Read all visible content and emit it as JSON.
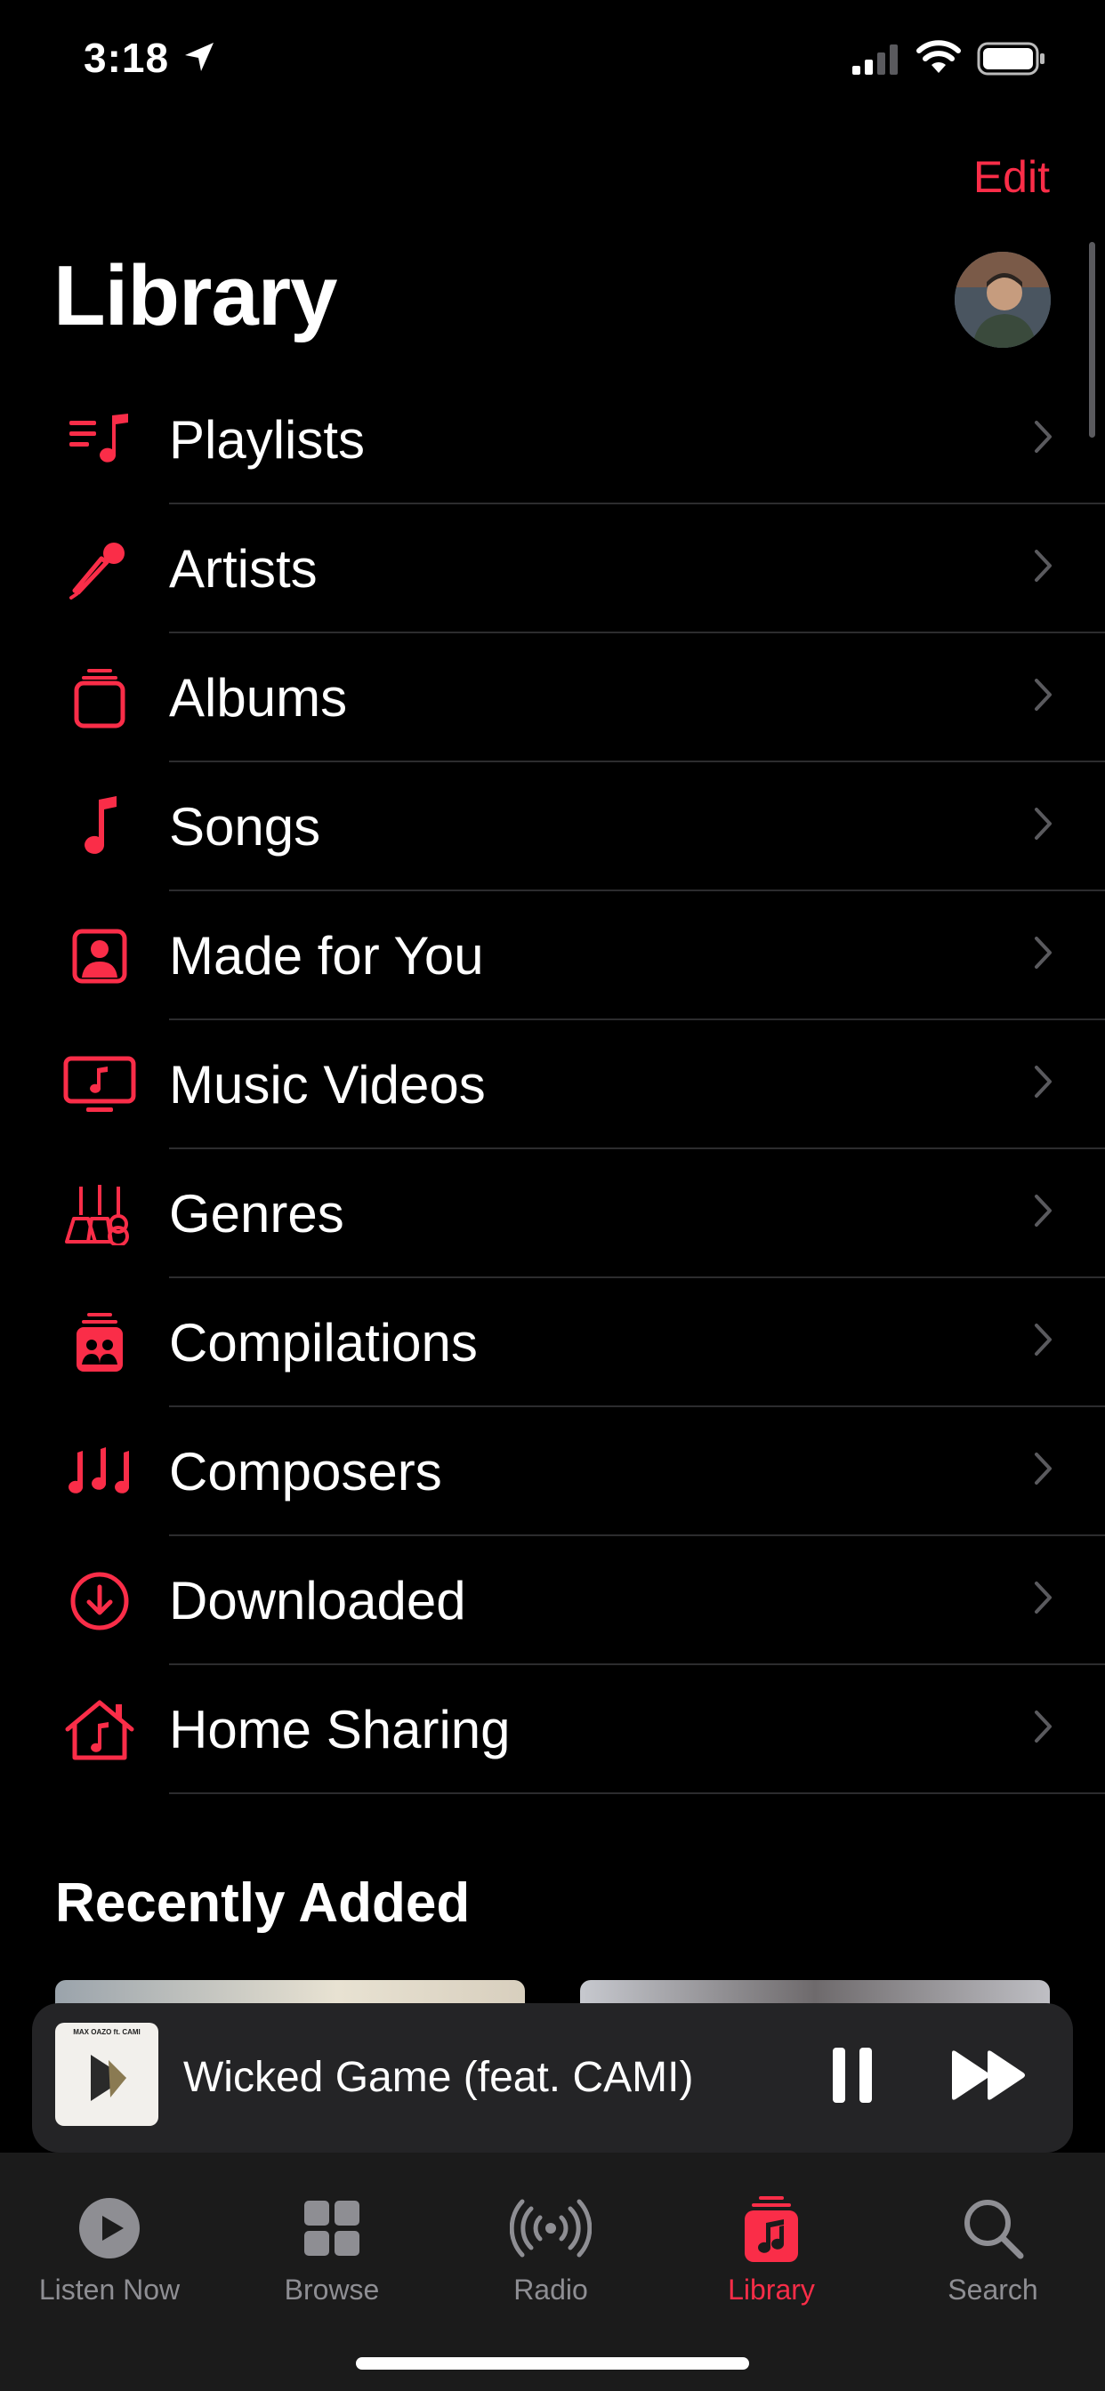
{
  "status": {
    "time": "3:18"
  },
  "header": {
    "edit_label": "Edit",
    "title": "Library"
  },
  "library_items": [
    {
      "label": "Playlists",
      "icon": "playlists-icon"
    },
    {
      "label": "Artists",
      "icon": "microphone-icon"
    },
    {
      "label": "Albums",
      "icon": "album-stack-icon"
    },
    {
      "label": "Songs",
      "icon": "music-note-icon"
    },
    {
      "label": "Made for You",
      "icon": "person-square-icon"
    },
    {
      "label": "Music Videos",
      "icon": "tv-music-icon"
    },
    {
      "label": "Genres",
      "icon": "guitars-icon"
    },
    {
      "label": "Compilations",
      "icon": "compilations-icon"
    },
    {
      "label": "Composers",
      "icon": "music-notes-icon"
    },
    {
      "label": "Downloaded",
      "icon": "download-circle-icon"
    },
    {
      "label": "Home Sharing",
      "icon": "home-music-icon"
    }
  ],
  "recently_added": {
    "title": "Recently Added"
  },
  "mini_player": {
    "song": "Wicked Game (feat. CAMI)",
    "art_text": "MAX OAZO ft. CAMI"
  },
  "tabs": [
    {
      "label": "Listen Now",
      "icon": "play-circle-icon"
    },
    {
      "label": "Browse",
      "icon": "grid-icon"
    },
    {
      "label": "Radio",
      "icon": "radio-waves-icon"
    },
    {
      "label": "Library",
      "icon": "library-music-icon",
      "active": true
    },
    {
      "label": "Search",
      "icon": "search-icon"
    }
  ],
  "colors": {
    "accent": "#fa2d48",
    "background": "#000000",
    "secondary_text": "#8e8e93"
  }
}
